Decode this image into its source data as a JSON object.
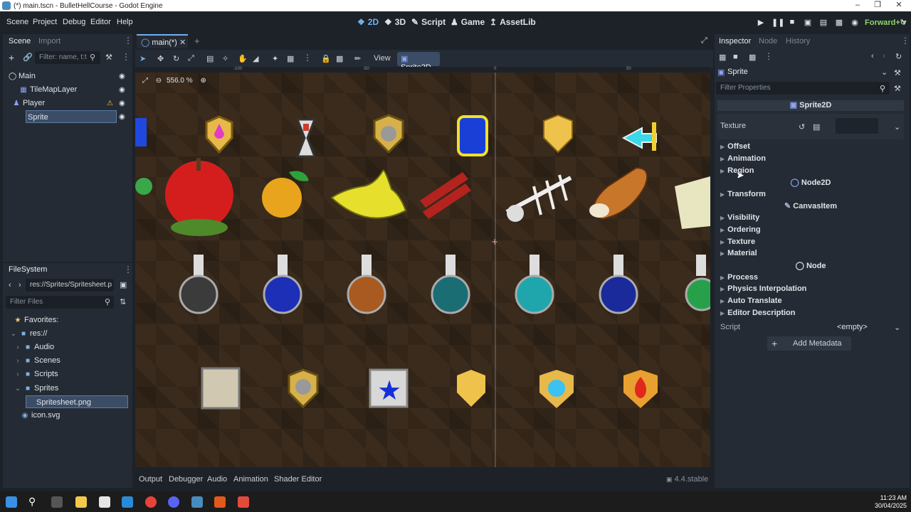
{
  "window": {
    "title": "(*) main.tscn - BulletHellCourse - Godot Engine"
  },
  "menu": [
    "Scene",
    "Project",
    "Debug",
    "Editor",
    "Help"
  ],
  "workspaces": [
    {
      "label": "2D",
      "icon": "2d-icon"
    },
    {
      "label": "3D",
      "icon": "3d-icon"
    },
    {
      "label": "Script",
      "icon": "script-icon"
    },
    {
      "label": "Game",
      "icon": "game-icon"
    },
    {
      "label": "AssetLib",
      "icon": "assetlib-icon"
    }
  ],
  "renderer": "Forward+",
  "scene_dock": {
    "tabs": [
      "Scene",
      "Import"
    ],
    "filter_placeholder": "Filter: name, t:t",
    "tree": [
      {
        "label": "Main"
      },
      {
        "label": "TileMapLayer"
      },
      {
        "label": "Player"
      },
      {
        "label": "Sprite"
      }
    ]
  },
  "filesystem": {
    "title": "FileSystem",
    "path": "res://Sprites/Spritesheet.p",
    "filter_placeholder": "Filter Files",
    "items": [
      {
        "label": "Favorites:"
      },
      {
        "label": "res://"
      },
      {
        "label": "Audio"
      },
      {
        "label": "Scenes"
      },
      {
        "label": "Scripts"
      },
      {
        "label": "Sprites"
      },
      {
        "label": "Spritesheet.png"
      },
      {
        "label": "icon.svg"
      }
    ]
  },
  "editor": {
    "tab": "main(*)",
    "view_menu": "View",
    "sprite2d_btn": "Sprite2D",
    "zoom": "556.0 %",
    "ruler": [
      "-100",
      "-50",
      "0",
      "50"
    ]
  },
  "bottom_panel": {
    "tabs": [
      "Output",
      "Debugger",
      "Audio",
      "Animation",
      "Shader Editor"
    ],
    "version": "4.4.stable"
  },
  "inspector": {
    "tabs": [
      "Inspector",
      "Node",
      "History"
    ],
    "object": "Sprite",
    "filter_placeholder": "Filter Properties",
    "sections": {
      "sprite2d": "Sprite2D",
      "texture_label": "Texture",
      "groups1": [
        "Offset",
        "Animation",
        "Region"
      ],
      "node2d": "Node2D",
      "groups2": [
        "Transform"
      ],
      "canvasitem": "CanvasItem",
      "groups3": [
        "Visibility",
        "Ordering",
        "Texture",
        "Material"
      ],
      "node": "Node",
      "groups4": [
        "Process",
        "Physics Interpolation",
        "Auto Translate",
        "Editor Description"
      ],
      "script_label": "Script",
      "script_value": "<empty>",
      "add_metadata": "Add Metadata"
    }
  },
  "taskbar": {
    "time": "11:23 AM",
    "date": "30/04/2025"
  },
  "colors": {
    "accent": "#6fb1f2",
    "panel": "#252b34",
    "background": "#1d2229",
    "renderer": "#8fd36b"
  }
}
